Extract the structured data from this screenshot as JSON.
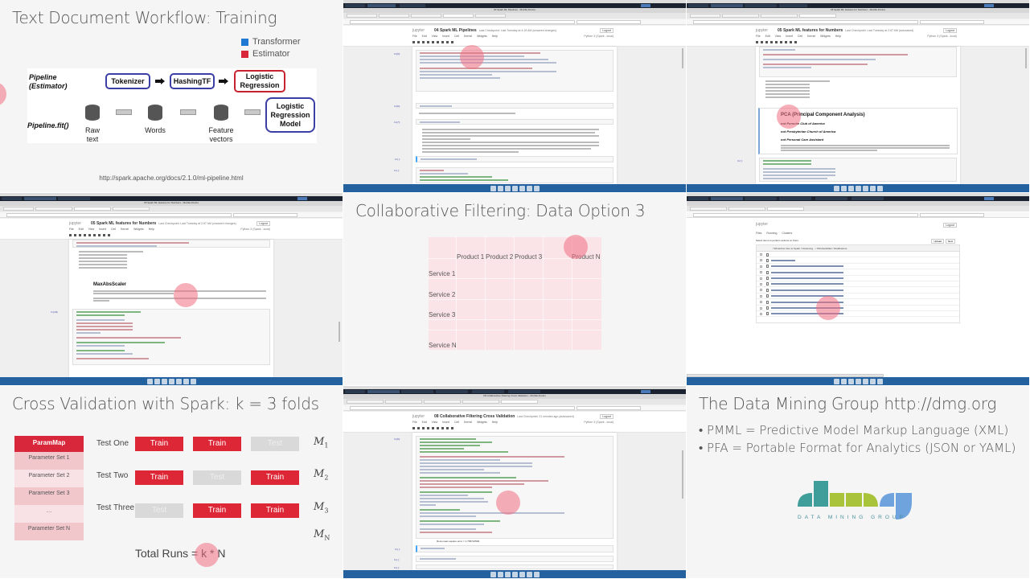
{
  "slide_pipeline": {
    "title": "Text Document Workflow:  Training",
    "legend": [
      {
        "label": "Transformer",
        "color": "#1f78d1"
      },
      {
        "label": "Estimator",
        "color": "#d8263a"
      }
    ],
    "row_labels": {
      "estimator": "Pipeline\n(Estimator)",
      "fit": "Pipeline.fit()"
    },
    "stages": [
      {
        "label": "Tokenizer",
        "kind": "transformer"
      },
      {
        "label": "HashingTF",
        "kind": "transformer"
      },
      {
        "label": "Logistic\nRegression",
        "kind": "estimator"
      }
    ],
    "data_items": [
      "Raw\ntext",
      "Words",
      "Feature\nvectors"
    ],
    "model_label": "Logistic\nRegression\nModel",
    "url": "http://spark.apache.org/docs/2.1.0/ml-pipeline.html"
  },
  "notebook_pipelines": {
    "window_title": "04 Spark ML Pipelines - Mozilla Firefox",
    "notebook_title": "04 Spark ML Pipelines",
    "checkpoint": "Last Checkpoint: Last Tuesday at 4:19 AM (unsaved changes)",
    "logout": "Logout",
    "menu": [
      "File",
      "Edit",
      "View",
      "Insert",
      "Cell",
      "Kernel",
      "Widgets",
      "Help"
    ],
    "kernel": "Python 3 (Spark - local)",
    "prompts": [
      "In [6]:",
      "In [6]:",
      "Out[6]:",
      "In [7]:",
      "Out[7]:",
      "In [ ]:",
      "In [ ]:"
    ]
  },
  "notebook_features_pca": {
    "window_title": "05 Spark ML features for Numbers - Mozilla Firefox",
    "notebook_title": "05 Spark ML features for Numbers",
    "checkpoint": "Last Checkpoint: Last Tuesday at 2:57 AM (autosaved)",
    "logout": "Logout",
    "menu": [
      "File",
      "Edit",
      "View",
      "Insert",
      "Cell",
      "Kernel",
      "Widgets",
      "Help"
    ],
    "kernel": "Python 3 (Spark - local)",
    "md_heading": "PCA (Principal Component Analysis)",
    "md_lines": [
      "not Porsche Club of America",
      "not Presbyterian Church of America",
      "not Personal Care Assistant"
    ],
    "prompt": "In [ ]:"
  },
  "notebook_features_maxabs": {
    "window_title": "05 Spark ML features for Numbers - Mozilla Firefox",
    "notebook_title": "05 Spark ML features for Numbers",
    "checkpoint": "Last Checkpoint: Last Tuesday at 2:57 AM (unsaved changes)",
    "logout": "Logout",
    "menu": [
      "File",
      "Edit",
      "View",
      "Insert",
      "Cell",
      "Kernel",
      "Widgets",
      "Help"
    ],
    "kernel": "Python 3 (Spark - local)",
    "md_heading": "MaxAbsScaler",
    "prompt": "In [16]:"
  },
  "slide_cf": {
    "title": "Collaborative Filtering: Data Option 3",
    "columns": [
      "Product 1",
      "Product 2",
      "Product 3",
      "",
      "Product N"
    ],
    "rows": [
      "Service 1",
      "Service 2",
      "Service 3",
      "Service N"
    ]
  },
  "jupyter_files": {
    "logo": "jupyter",
    "logout": "Logout",
    "tabs": [
      "Files",
      "Running",
      "Clusters"
    ],
    "select_hint": "Select items to perform actions on them.",
    "upload": "Upload",
    "new": "New",
    "breadcrumb": "/ Winterfest Intro to Spark / Clustering... / WindowsMain / RealFactors",
    "files": [
      ".. ",
      "_SUCCESS",
      "part-00000-snappy.parquet",
      "part-00001-snappy.parquet",
      "part-00002-snappy.parquet",
      "part-00003-snappy.parquet",
      "part-00004-snappy.parquet",
      "part-00005-snappy.parquet",
      "part-00006-snappy.parquet",
      "part-00007-snappy.parquet",
      "part-00008-snappy.parquet"
    ]
  },
  "slide_cv": {
    "title": "Cross Validation with Spark:  k = 3 folds",
    "parammap": {
      "header": "ParamMap",
      "rows": [
        "Parameter Set 1",
        "Parameter Set 2",
        "Parameter Set 3",
        "…",
        "Parameter Set N"
      ]
    },
    "tests": [
      {
        "label": "Test One",
        "folds": [
          "Train",
          "Train",
          "Test"
        ],
        "model": "M",
        "sub": "1"
      },
      {
        "label": "Test Two",
        "folds": [
          "Train",
          "Test",
          "Train"
        ],
        "model": "M",
        "sub": "2"
      },
      {
        "label": "Test Three",
        "folds": [
          "Test",
          "Train",
          "Train"
        ],
        "model": "M",
        "sub": "3"
      }
    ],
    "model_n": {
      "model": "M",
      "sub": "N"
    },
    "total": "Total Runs = k * N"
  },
  "notebook_cf_cv": {
    "window_title": "08 Collaborative Filtering Cross Validation - Mozilla Firefox",
    "notebook_title": "08 Collaborative Filtering Cross Validation",
    "checkpoint": "Last Checkpoint: 21 minutes ago (autosaved)",
    "logout": "Logout",
    "menu": [
      "File",
      "Edit",
      "View",
      "Insert",
      "Cell",
      "Kernel",
      "Widgets",
      "Help"
    ],
    "kernel": "Python 3 (Spark - local)",
    "prompts": [
      "In [6]:",
      "In [ ]:",
      "In [ ]:",
      "In [ ]:"
    ],
    "output": "Root-mean-square error = 1.768724509"
  },
  "slide_dmg": {
    "title": "The Data Mining Group  http://dmg.org",
    "bullets": [
      "PMML = Predictive Model Markup Language (XML)",
      "PFA = Portable Format for Analytics (JSON or YAML)"
    ],
    "logo_text": "DATA MINING GROUP",
    "logo_colors": [
      "#3f9d9a",
      "#a9c43b",
      "#6ea3dd"
    ]
  }
}
